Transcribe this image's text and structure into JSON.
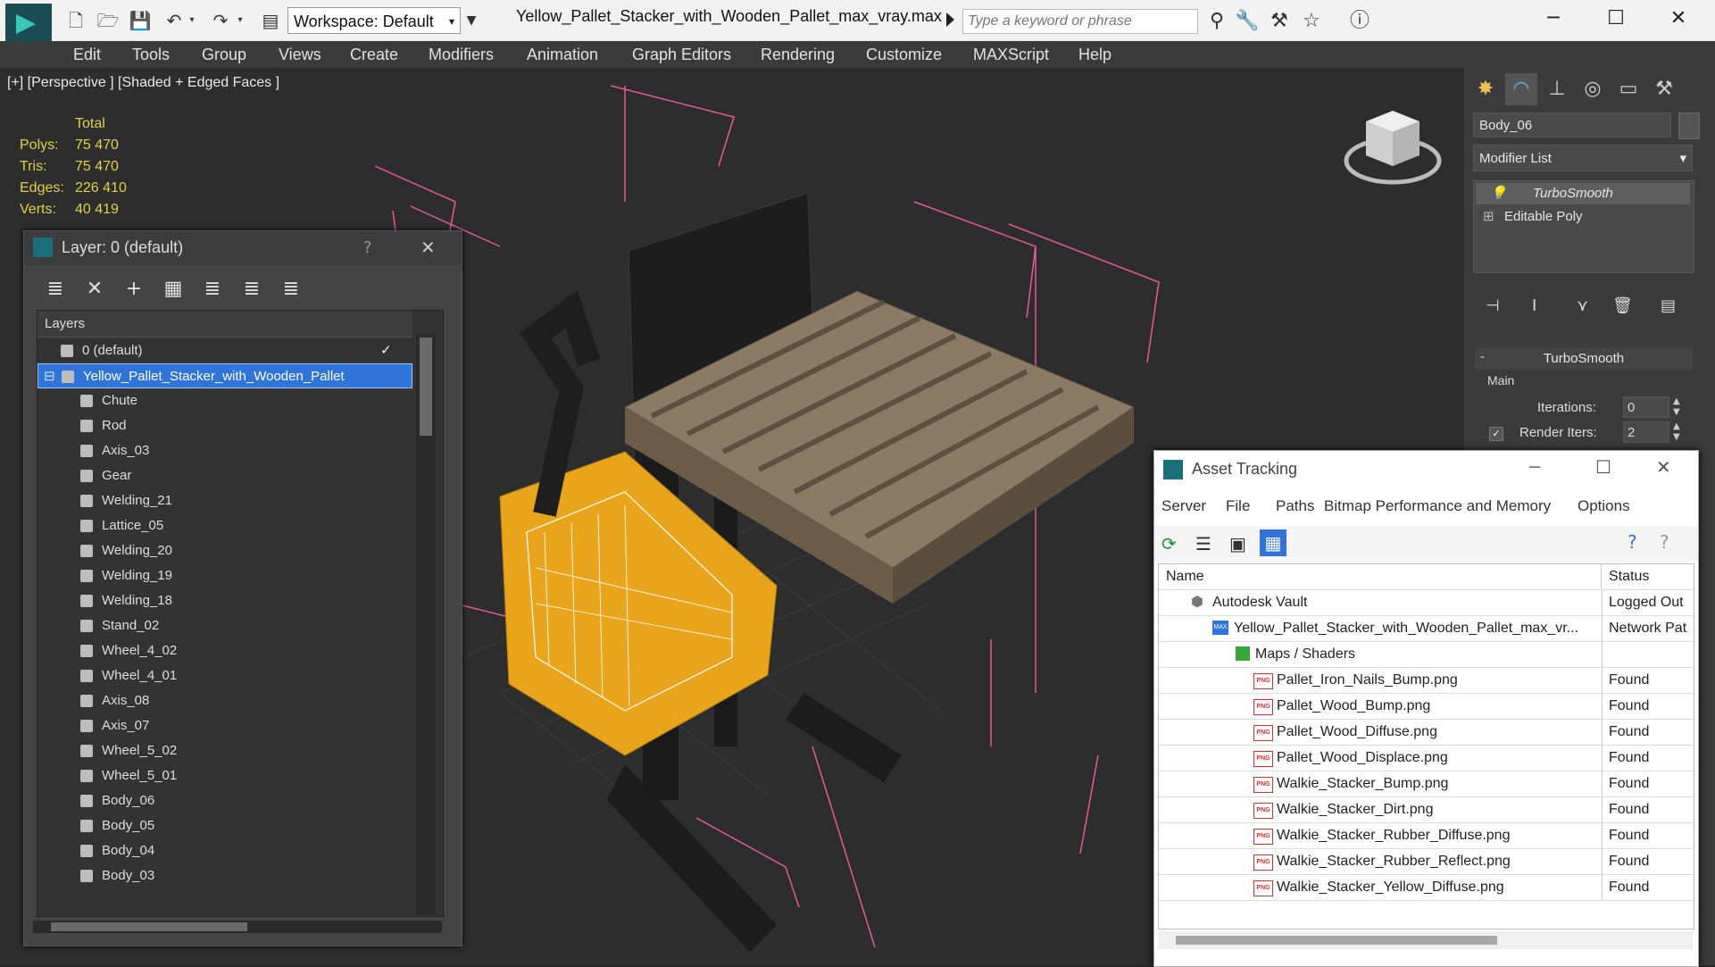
{
  "titlebar": {
    "workspace_label": "Workspace: Default",
    "document_title": "Yellow_Pallet_Stacker_with_Wooden_Pallet_max_vray.max",
    "search_placeholder": "Type a keyword or phrase"
  },
  "menu": {
    "items": [
      "Edit",
      "Tools",
      "Group",
      "Views",
      "Create",
      "Modifiers",
      "Animation",
      "Graph Editors",
      "Rendering",
      "Customize",
      "MAXScript",
      "Help"
    ]
  },
  "viewport": {
    "label": "[+] [Perspective ] [Shaded + Edged Faces ]",
    "stats": {
      "header": "Total",
      "rows": [
        {
          "label": "Polys:",
          "value": "75 470"
        },
        {
          "label": "Tris:",
          "value": "75 470"
        },
        {
          "label": "Edges:",
          "value": "226 410"
        },
        {
          "label": "Verts:",
          "value": "40 419"
        }
      ]
    }
  },
  "layer_dialog": {
    "title": "Layer: 0 (default)",
    "help": "?",
    "close": "✕",
    "header": "Layers",
    "rows": [
      {
        "name": "0 (default)",
        "level": 0
      },
      {
        "name": "Yellow_Pallet_Stacker_with_Wooden_Pallet",
        "level": 0
      },
      {
        "name": "Chute",
        "level": 1
      },
      {
        "name": "Rod",
        "level": 1
      },
      {
        "name": "Axis_03",
        "level": 1
      },
      {
        "name": "Gear",
        "level": 1
      },
      {
        "name": "Welding_21",
        "level": 1
      },
      {
        "name": "Lattice_05",
        "level": 1
      },
      {
        "name": "Welding_20",
        "level": 1
      },
      {
        "name": "Welding_19",
        "level": 1
      },
      {
        "name": "Welding_18",
        "level": 1
      },
      {
        "name": "Stand_02",
        "level": 1
      },
      {
        "name": "Wheel_4_02",
        "level": 1
      },
      {
        "name": "Wheel_4_01",
        "level": 1
      },
      {
        "name": "Axis_08",
        "level": 1
      },
      {
        "name": "Axis_07",
        "level": 1
      },
      {
        "name": "Wheel_5_02",
        "level": 1
      },
      {
        "name": "Wheel_5_01",
        "level": 1
      },
      {
        "name": "Body_06",
        "level": 1
      },
      {
        "name": "Body_05",
        "level": 1
      },
      {
        "name": "Body_04",
        "level": 1
      },
      {
        "name": "Body_03",
        "level": 1
      }
    ]
  },
  "command_panel": {
    "object_name": "Body_06",
    "modifier_list": "Modifier List",
    "stack": [
      "TurboSmooth",
      "Editable Poly"
    ],
    "rollout_title": "TurboSmooth",
    "group_main": "Main",
    "iterations_label": "Iterations:",
    "iterations_value": "0",
    "render_iters_label": "Render Iters:",
    "render_iters_value": "2"
  },
  "asset_dialog": {
    "title": "Asset Tracking",
    "menu": [
      "Server",
      "File",
      "Paths",
      "Bitmap Performance and Memory",
      "Options"
    ],
    "col_name": "Name",
    "col_status": "Status",
    "rows": [
      {
        "name": "Autodesk Vault",
        "status": "Logged Out",
        "indent": 1,
        "icon": "vault-icon"
      },
      {
        "name": "Yellow_Pallet_Stacker_with_Wooden_Pallet_max_vr...",
        "status": "Network Pat",
        "indent": 2,
        "icon": "max-file-icon"
      },
      {
        "name": "Maps / Shaders",
        "status": "",
        "indent": 3,
        "icon": "maps-icon"
      },
      {
        "name": "Pallet_Iron_Nails_Bump.png",
        "status": "Found",
        "indent": 4,
        "icon": "png-icon"
      },
      {
        "name": "Pallet_Wood_Bump.png",
        "status": "Found",
        "indent": 4,
        "icon": "png-icon"
      },
      {
        "name": "Pallet_Wood_Diffuse.png",
        "status": "Found",
        "indent": 4,
        "icon": "png-icon"
      },
      {
        "name": "Pallet_Wood_Displace.png",
        "status": "Found",
        "indent": 4,
        "icon": "png-icon"
      },
      {
        "name": "Walkie_Stacker_Bump.png",
        "status": "Found",
        "indent": 4,
        "icon": "png-icon"
      },
      {
        "name": "Walkie_Stacker_Dirt.png",
        "status": "Found",
        "indent": 4,
        "icon": "png-icon"
      },
      {
        "name": "Walkie_Stacker_Rubber_Diffuse.png",
        "status": "Found",
        "indent": 4,
        "icon": "png-icon"
      },
      {
        "name": "Walkie_Stacker_Rubber_Reflect.png",
        "status": "Found",
        "indent": 4,
        "icon": "png-icon"
      },
      {
        "name": "Walkie_Stacker_Yellow_Diffuse.png",
        "status": "Found",
        "indent": 4,
        "icon": "png-icon"
      }
    ]
  },
  "colors": {
    "accent_select": "#2f74d6",
    "stats_text": "#e3d14a",
    "gizmo_pink": "#e85a9a",
    "stacker_yellow": "#e8a51c"
  }
}
